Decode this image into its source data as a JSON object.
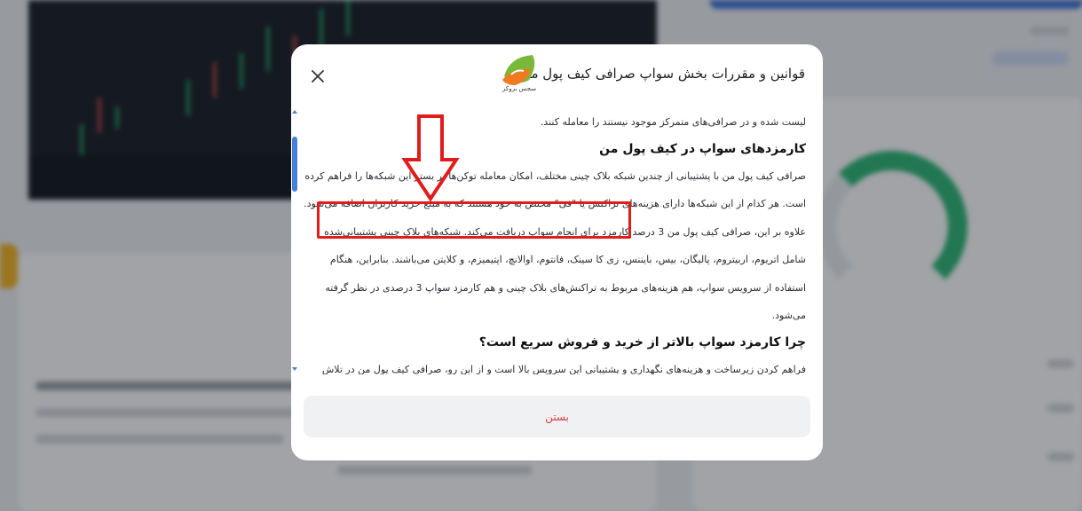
{
  "modal": {
    "title": "قوانین و مقررات بخش سواپ صرافی کیف پول من",
    "brand_caption": "سجس بروکر",
    "close_label": "بستن",
    "paragraphs_intro": "لیست شده و در صرافی‌های متمرکز موجود نیستند را معامله کنند.",
    "section1_heading": "کارمزدهای سواپ در کیف پول من",
    "section1_text_a": "صرافی کیف پول من با پشتیبانی از چندین شبکه بلاک چینی مختلف، امکان معامله توکن‌ها بر بستر این شبکه‌ها را فراهم کرده است. هر کدام از این شبکه‌ها دارای هزینه‌های تراکنش یا \"فی\" مختص به خود هستند که به مبلغ خرید کاربران اضافه می‌شود. علاوه بر این، ",
    "section1_text_highlight": "صرافی کیف پول من 3 درصد کارمزد برای انجام سواپ دریافت می‌کند.",
    "section1_text_b": " شبکه‌های بلاک چینی پشتیبانی‌شده شامل اتریوم، اربیتروم، پالیگان، بیس، بایننس، زی کا سینک، فانتوم، اوالانچ، اپتیمیزم، و کلایتن می‌باشند. بنابراین، هنگام استفاده از سرویس سواپ، هم هزینه‌های مربوط به تراکنش‌های بلاک چینی و هم کارمزد سواپ 3 درصدی در نظر گرفته می‌شود.",
    "section2_heading": "چرا کارمزد سواپ بالاتر از خرید و فروش سریع است؟",
    "section2_text": "فراهم کردن زیرساخت و هزینه‌های نگهداری و پشتیبانی این سرویس بالا است و از این رو، صرافی کیف پول من در تلاش بوده تا کمترین کارمزد ممکن را لحاظ کند تا همه کاربران بتوانند از این سرویس بهره‌مند شوند و امکان معامله"
  },
  "colors": {
    "accent_blue": "#4a7fd8",
    "annotation_red": "#e21b1b",
    "close_text_red": "#d93a3a"
  },
  "icons": {
    "close": "close-icon",
    "brand": "brand-logo-icon",
    "arrow": "down-arrow-annotation-icon"
  }
}
